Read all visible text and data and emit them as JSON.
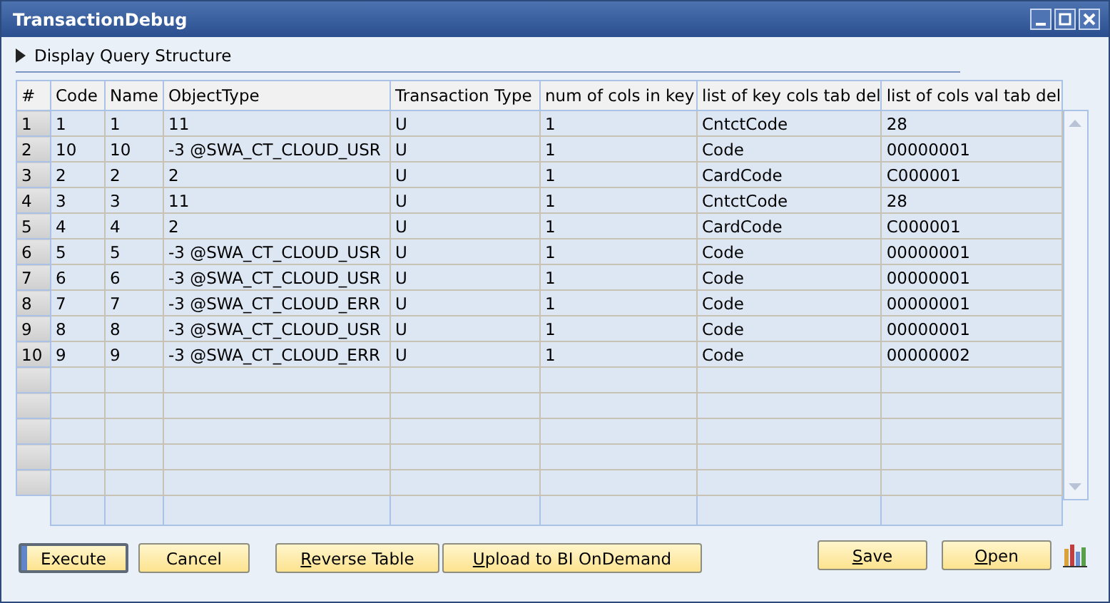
{
  "window": {
    "title": "TransactionDebug"
  },
  "expander": {
    "label": "Display Query Structure",
    "expanded": false
  },
  "table": {
    "columns": [
      "#",
      "Code",
      "Name",
      "ObjectType",
      "Transaction Type",
      "num of cols in key",
      "list of key cols tab del",
      "list of cols val tab del"
    ],
    "rows": [
      [
        "1",
        "1",
        "1",
        "11",
        "U",
        "1",
        "CntctCode",
        "28"
      ],
      [
        "2",
        "10",
        "10",
        "-3 @SWA_CT_CLOUD_USR",
        "U",
        "1",
        "Code",
        "00000001"
      ],
      [
        "3",
        "2",
        "2",
        "2",
        "U",
        "1",
        "CardCode",
        "C000001"
      ],
      [
        "4",
        "3",
        "3",
        "11",
        "U",
        "1",
        "CntctCode",
        "28"
      ],
      [
        "5",
        "4",
        "4",
        "2",
        "U",
        "1",
        "CardCode",
        "C000001"
      ],
      [
        "6",
        "5",
        "5",
        "-3 @SWA_CT_CLOUD_USR",
        "U",
        "1",
        "Code",
        "00000001"
      ],
      [
        "7",
        "6",
        "6",
        "-3 @SWA_CT_CLOUD_USR",
        "U",
        "1",
        "Code",
        "00000001"
      ],
      [
        "8",
        "7",
        "7",
        "-3 @SWA_CT_CLOUD_ERR",
        "U",
        "1",
        "Code",
        "00000001"
      ],
      [
        "9",
        "8",
        "8",
        "-3 @SWA_CT_CLOUD_USR",
        "U",
        "1",
        "Code",
        "00000001"
      ],
      [
        "10",
        "9",
        "9",
        "-3 @SWA_CT_CLOUD_ERR",
        "U",
        "1",
        "Code",
        "00000002"
      ]
    ]
  },
  "buttons": [
    {
      "label": "Execute",
      "default": true
    },
    {
      "label": "Cancel",
      "default": false
    },
    {
      "label": "Reverse Table",
      "default": false
    },
    {
      "label": "Upload to BI OnDemand",
      "default": false
    },
    {
      "label": "Save",
      "default": false
    },
    {
      "label": "Open",
      "default": false
    }
  ]
}
